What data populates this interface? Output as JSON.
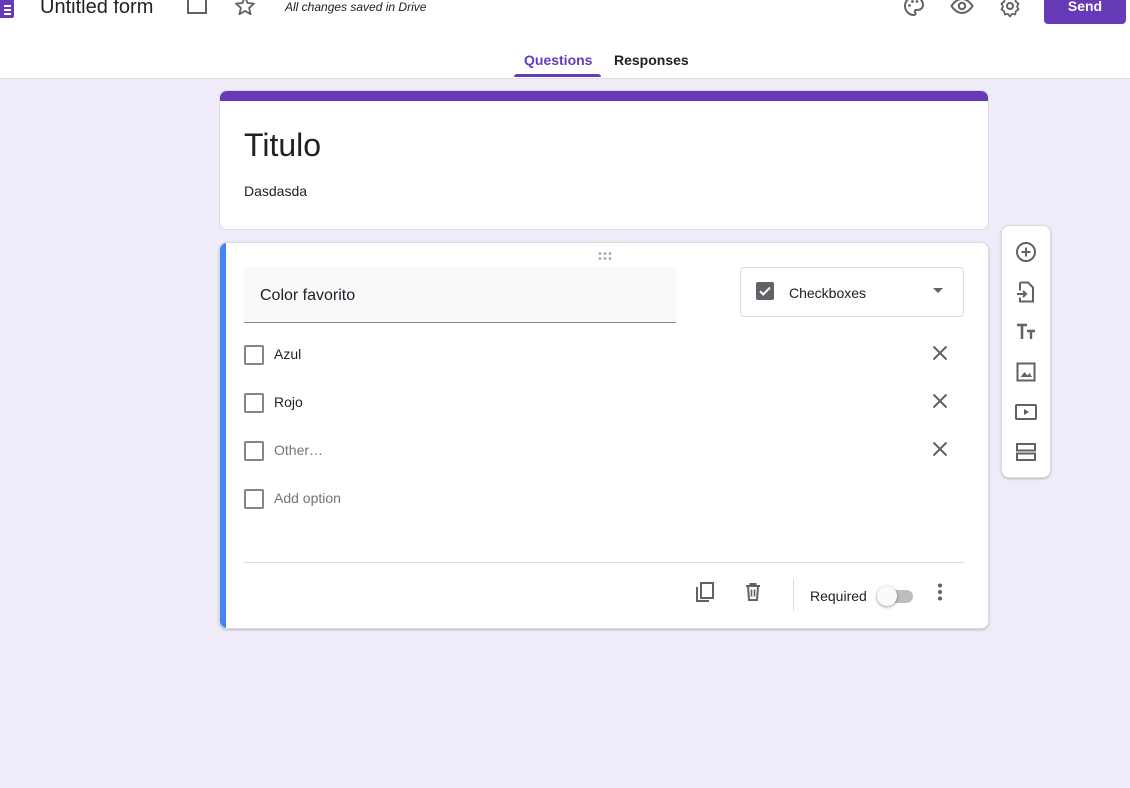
{
  "header": {
    "form_title": "Untitled form",
    "save_status": "All changes saved in Drive",
    "send_label": "Send",
    "icons": [
      "folder-icon",
      "star-icon",
      "palette-icon",
      "preview-eye-icon",
      "settings-gear-icon"
    ]
  },
  "tabs": [
    {
      "label": "Questions",
      "active": true
    },
    {
      "label": "Responses",
      "active": false
    }
  ],
  "title_card": {
    "title": "Titulo",
    "description": "Dasdasda"
  },
  "question": {
    "text": "Color favorito",
    "type_label": "Checkboxes",
    "options": [
      {
        "label": "Azul"
      },
      {
        "label": "Rojo"
      },
      {
        "label": "Other…"
      }
    ],
    "add_option": "Add option",
    "required_label": "Required",
    "required": false
  },
  "side_toolbar": {
    "tools": [
      "add-question-icon",
      "import-questions-icon",
      "add-title-description-icon",
      "add-image-icon",
      "add-video-icon",
      "add-section-icon"
    ]
  },
  "colors": {
    "brand": "#673ab7",
    "background": "#f0ebf8",
    "question_accent": "#4285f4"
  }
}
